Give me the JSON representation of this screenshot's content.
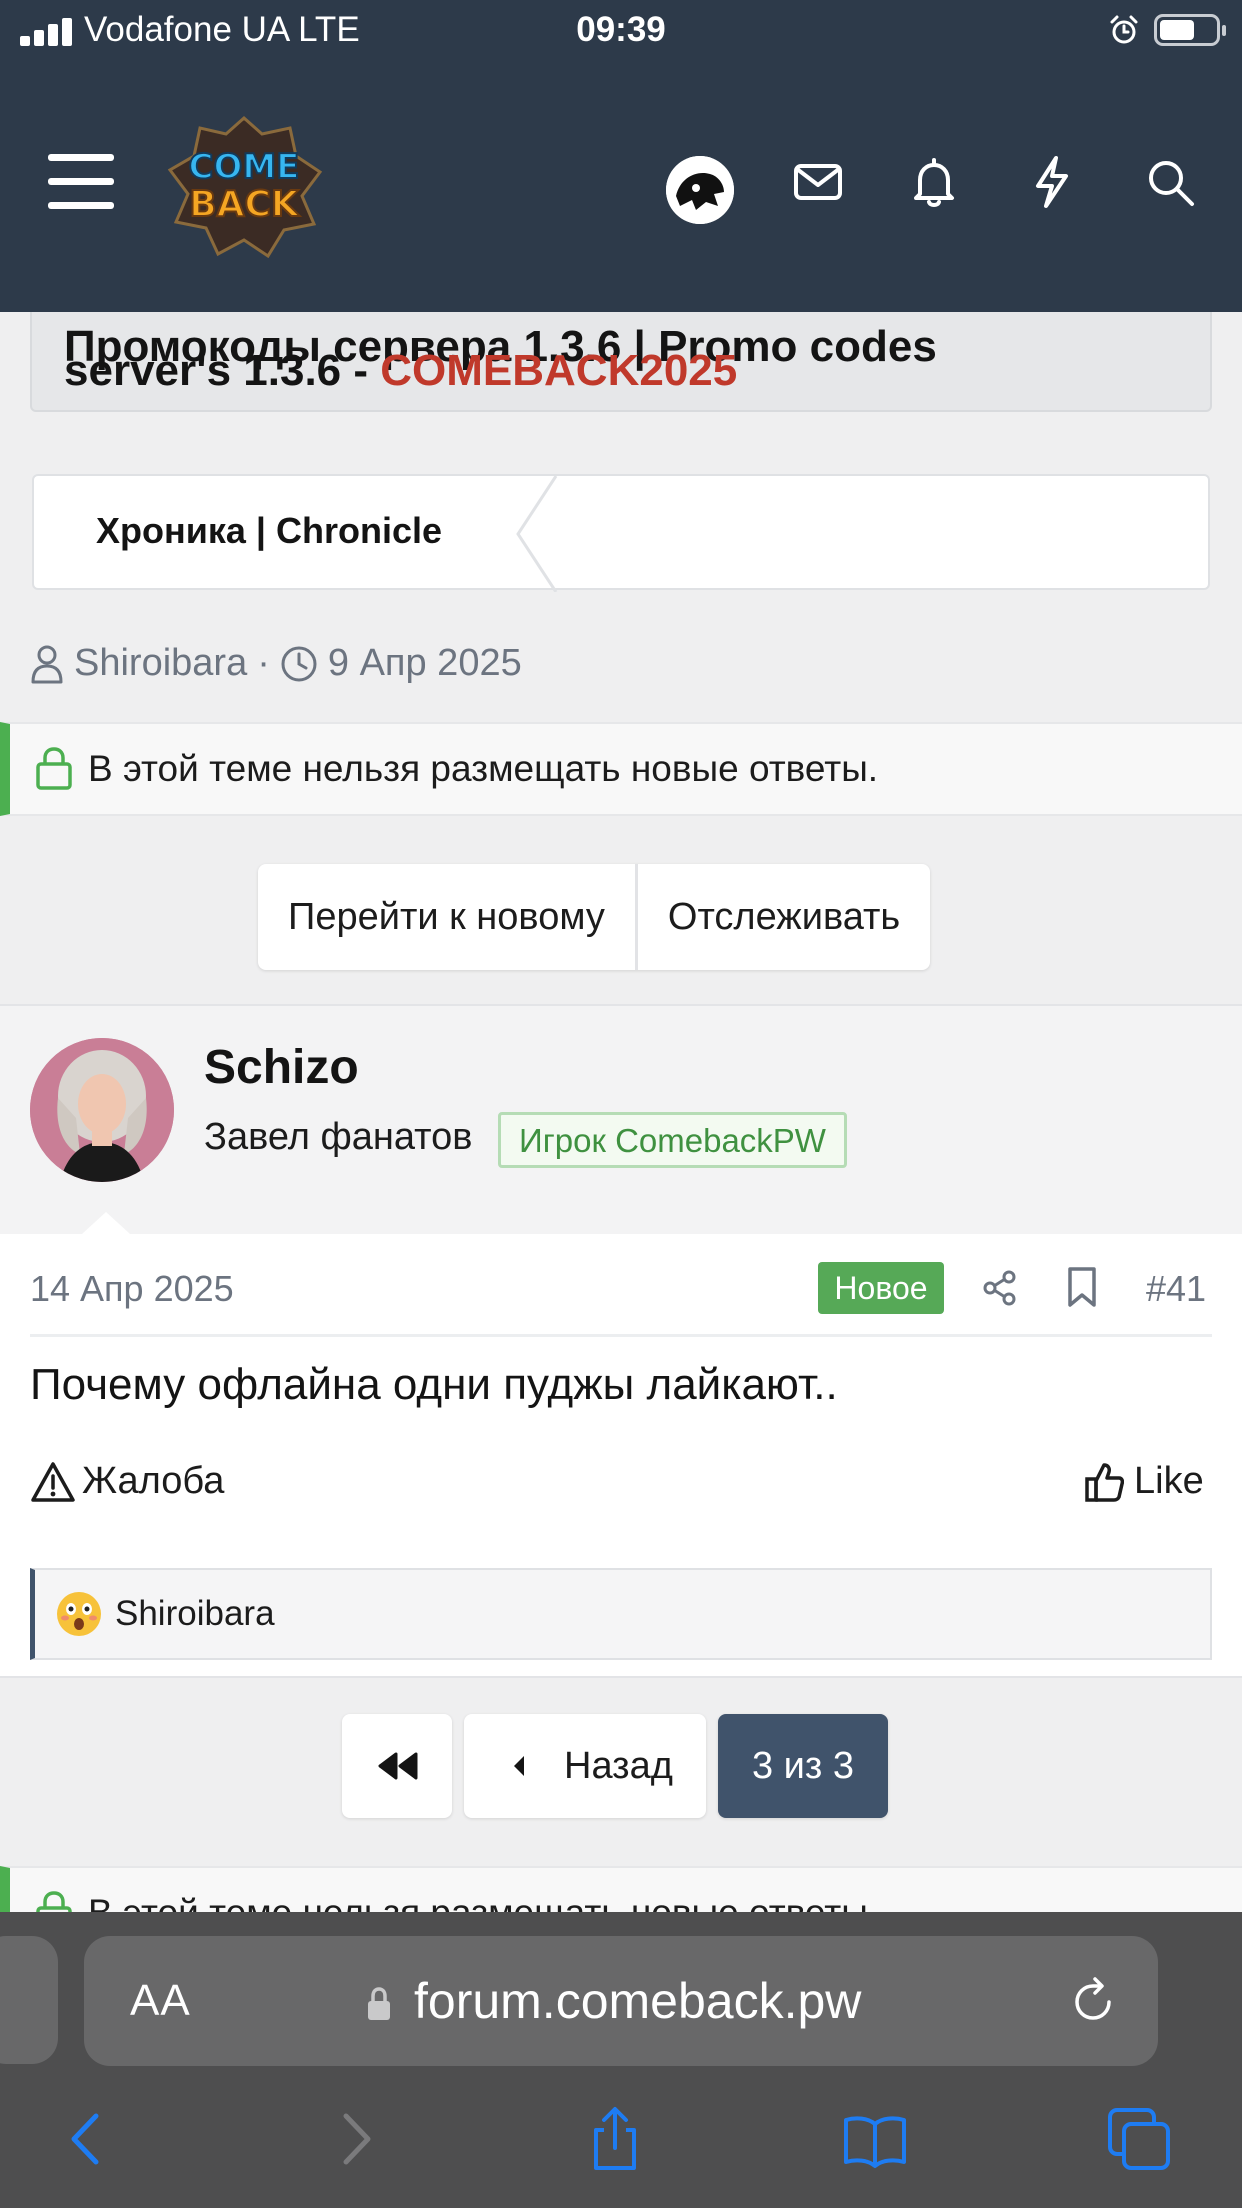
{
  "status_bar": {
    "carrier": "Vodafone UA   LTE",
    "time": "09:39"
  },
  "header": {
    "logo_text": "COME BACK",
    "icons": [
      "menu-icon",
      "avatar",
      "mail-icon",
      "bell-icon",
      "lightning-icon",
      "search-icon"
    ]
  },
  "thread": {
    "title_line1": "Промокоды сервера 1.3.6 | Promo codes",
    "title_line2_prefix": "server's 1.3.6 - ",
    "title_line2_accent": "COMEBACK2025",
    "breadcrumb": "Хроника | Chronicle",
    "author": "Shiroibara",
    "sep": "·",
    "date": "9 Апр 2025",
    "locked_notice": "В этой теме нельзя размещать новые ответы."
  },
  "actions": {
    "goto_new": "Перейти к новому",
    "watch": "Отслеживать"
  },
  "post": {
    "username": "Schizo",
    "user_title": "Завел фанатов",
    "user_badge": "Игрок ComebackPW",
    "date": "14 Апр 2025",
    "new_badge": "Новое",
    "number": "#41",
    "text": "Почему офлайна одни пуджы лайкают..",
    "report": "Жалоба",
    "like": "Like",
    "reaction_user": "Shiroibara"
  },
  "pagination": {
    "back": "Назад",
    "current": "3 из 3"
  },
  "browser": {
    "aa": "AA",
    "url": "forum.comeback.pw"
  },
  "colors": {
    "header_bg": "#2d3a4a",
    "accent_red": "#c0392b",
    "green": "#4caf50",
    "pager_active": "#40536b",
    "ios_blue": "#1e7cf2"
  }
}
